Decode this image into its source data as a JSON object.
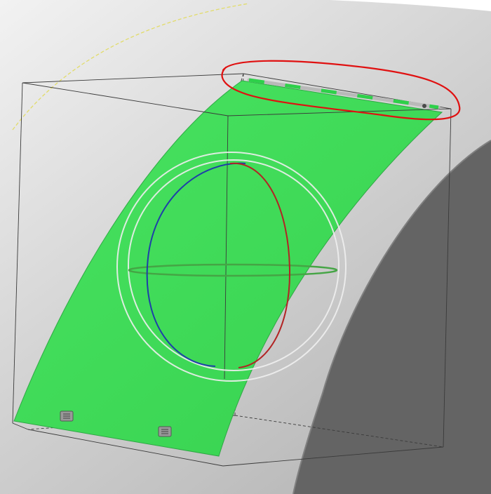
{
  "viewport": {
    "background_gradient": [
      "#f2f2f2",
      "#d4d4d4",
      "#b7b7b7"
    ],
    "cylinder_face_color": "#646464"
  },
  "surface": {
    "fill_color": "#3fdb58",
    "edge_color": "#2fa845"
  },
  "bounding_box": {
    "line_color": "#3a3a3a",
    "hidden_line_style": "dashed"
  },
  "rotate_manipulator": {
    "outer_ring_color": "#eeeeee",
    "x_ring_color": "#b22424",
    "y_ring_color": "#1e3fa8",
    "z_ring_color": "#45a545"
  },
  "annotation": {
    "type": "freehand-ellipse",
    "color": "#e01010"
  },
  "guide_arc_color": "#e2dc6a",
  "handles": [
    {
      "icon": "grip-handle-icon"
    },
    {
      "icon": "grip-handle-icon"
    }
  ]
}
